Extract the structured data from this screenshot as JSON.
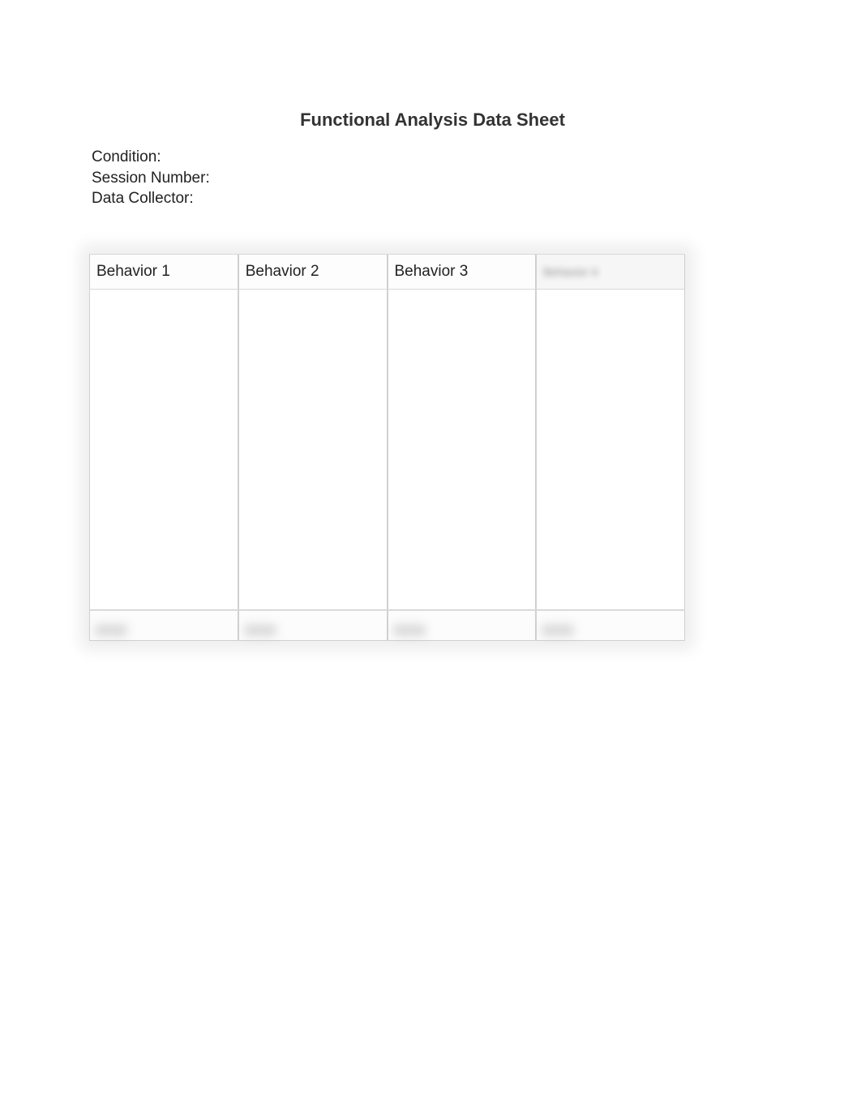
{
  "title": "Functional Analysis Data Sheet",
  "fields": {
    "condition_label": "Condition:",
    "session_number_label": "Session Number:",
    "data_collector_label": "Data Collector:"
  },
  "columns": [
    {
      "label": "Behavior 1"
    },
    {
      "label": "Behavior 2"
    },
    {
      "label": "Behavior 3"
    },
    {
      "label": "Behavior 4"
    }
  ],
  "footer_labels": [
    "Total",
    "Total",
    "Total",
    "Total"
  ]
}
